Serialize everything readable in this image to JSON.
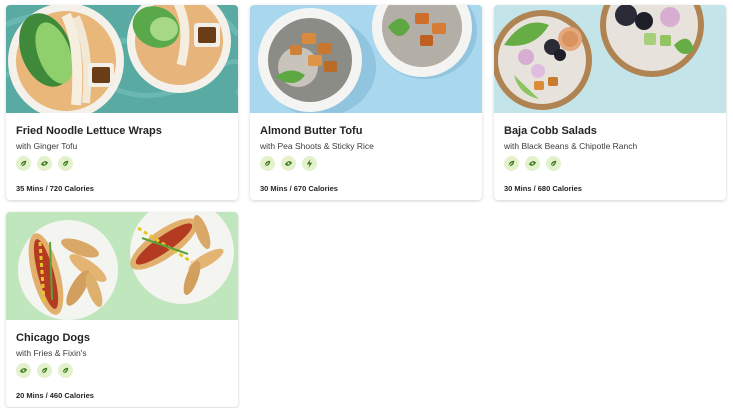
{
  "recipes": [
    {
      "title": "Fried Noodle Lettuce Wraps",
      "subtitle": "with Ginger Tofu",
      "meta": "35 Mins / 720 Calories",
      "tags": [
        "leaf-tag-icon",
        "swirl-tag-icon",
        "leaf-tag-icon"
      ],
      "image_bg": "#4fa7a0"
    },
    {
      "title": "Almond Butter Tofu",
      "subtitle": "with Pea Shoots & Sticky Rice",
      "meta": "30 Mins / 670 Calories",
      "tags": [
        "leaf-tag-icon",
        "swirl-tag-icon",
        "bolt-tag-icon"
      ],
      "image_bg": "#a9d8ee"
    },
    {
      "title": "Baja Cobb Salads",
      "subtitle": "with Black Beans & Chipotle Ranch",
      "meta": "30 Mins / 680 Calories",
      "tags": [
        "leaf-tag-icon",
        "swirl-tag-icon",
        "leaf-tag-icon"
      ],
      "image_bg": "#bfe3e9"
    },
    {
      "title": "Chicago Dogs",
      "subtitle": "with Fries & Fixin's",
      "meta": "20 Mins / 460 Calories",
      "tags": [
        "swirl-tag-icon",
        "leaf-tag-icon",
        "leaf-tag-icon"
      ],
      "image_bg": "#bfe6bd"
    }
  ],
  "colors": {
    "tag_bg": "#e3f1cc",
    "tag_icon": "#3d7a1c",
    "title": "#242424"
  }
}
